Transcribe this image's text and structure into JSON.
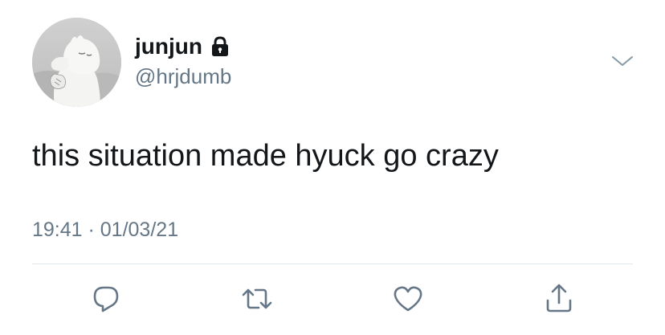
{
  "tweet": {
    "display_name": "junjun",
    "handle": "@hrjdumb",
    "text": "this situation made hyuck go crazy",
    "time": "19:41",
    "separator": "·",
    "date": "01/03/21",
    "meta_text": "19:41 · 01/03/21",
    "protected_icon": "lock-icon",
    "more_icon": "chevron-down-icon"
  },
  "actions": [
    {
      "name": "reply",
      "icon": "reply-icon"
    },
    {
      "name": "retweet",
      "icon": "retweet-icon"
    },
    {
      "name": "like",
      "icon": "heart-icon"
    },
    {
      "name": "share",
      "icon": "share-icon"
    }
  ],
  "colors": {
    "text_primary": "#14171a",
    "text_secondary": "#657786",
    "icon_gray": "#657786",
    "divider": "#e1e8ed"
  }
}
